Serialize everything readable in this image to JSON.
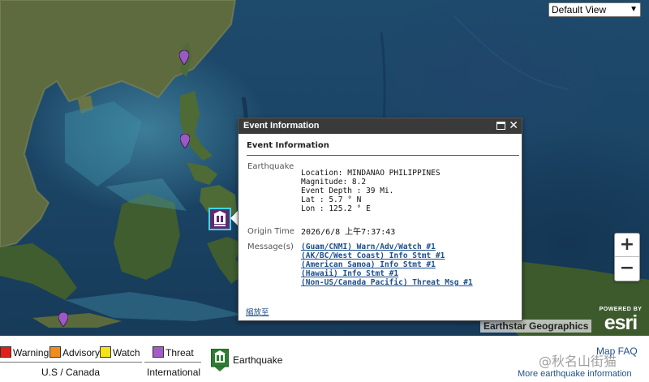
{
  "map": {
    "view_select": {
      "selected": "Default View"
    },
    "zoom": {
      "in_label": "+",
      "out_label": "−"
    },
    "attribution": "Earthstar Geographics",
    "esri": {
      "powered_by": "POWERED BY",
      "logo_text": "esri"
    },
    "colors": {
      "quake_marker_bg": "#5a2b6e",
      "quake_marker_border": "#3dd6e6",
      "pin": "#9b59c6"
    }
  },
  "popup": {
    "header_title": "Event Information",
    "title": "Event Information",
    "earthquake_label": "Earthquake",
    "location": "Location: MINDANAO PHILIPPINES",
    "magnitude": "Magnitude: 8.2",
    "depth": "Event Depth : 39 Mi.",
    "lat": "Lat : 5.7 ° N",
    "lon": "Lon : 125.2 ° E",
    "origin_time_label": "Origin Time",
    "origin_time": "2026/6/8 上午7:37:43",
    "messages_label": "Message(s)",
    "messages": [
      "(Guam/CNMI) Warn/Adv/Watch #1",
      "(AK/BC/West Coast) Info Stmt #1",
      "(American Samoa) Info Stmt #1",
      "(Hawaii) Info Stmt #1",
      "(Non-US/Canada Pacific) Threat Msg #1"
    ],
    "zoom_link": "縮放至"
  },
  "legend": {
    "items": [
      {
        "label": "Warning",
        "color": "#e0201c"
      },
      {
        "label": "Advisory",
        "color": "#f28c1e"
      },
      {
        "label": "Watch",
        "color": "#f5e31a"
      },
      {
        "label": "Threat",
        "color": "#a35cc8"
      }
    ],
    "us_canada": "U.S / Canada",
    "international": "International",
    "earthquake": "Earthquake",
    "map_faq": "Map FAQ",
    "more_info": "More earthquake information",
    "watermark": "@秋名山街猫"
  }
}
